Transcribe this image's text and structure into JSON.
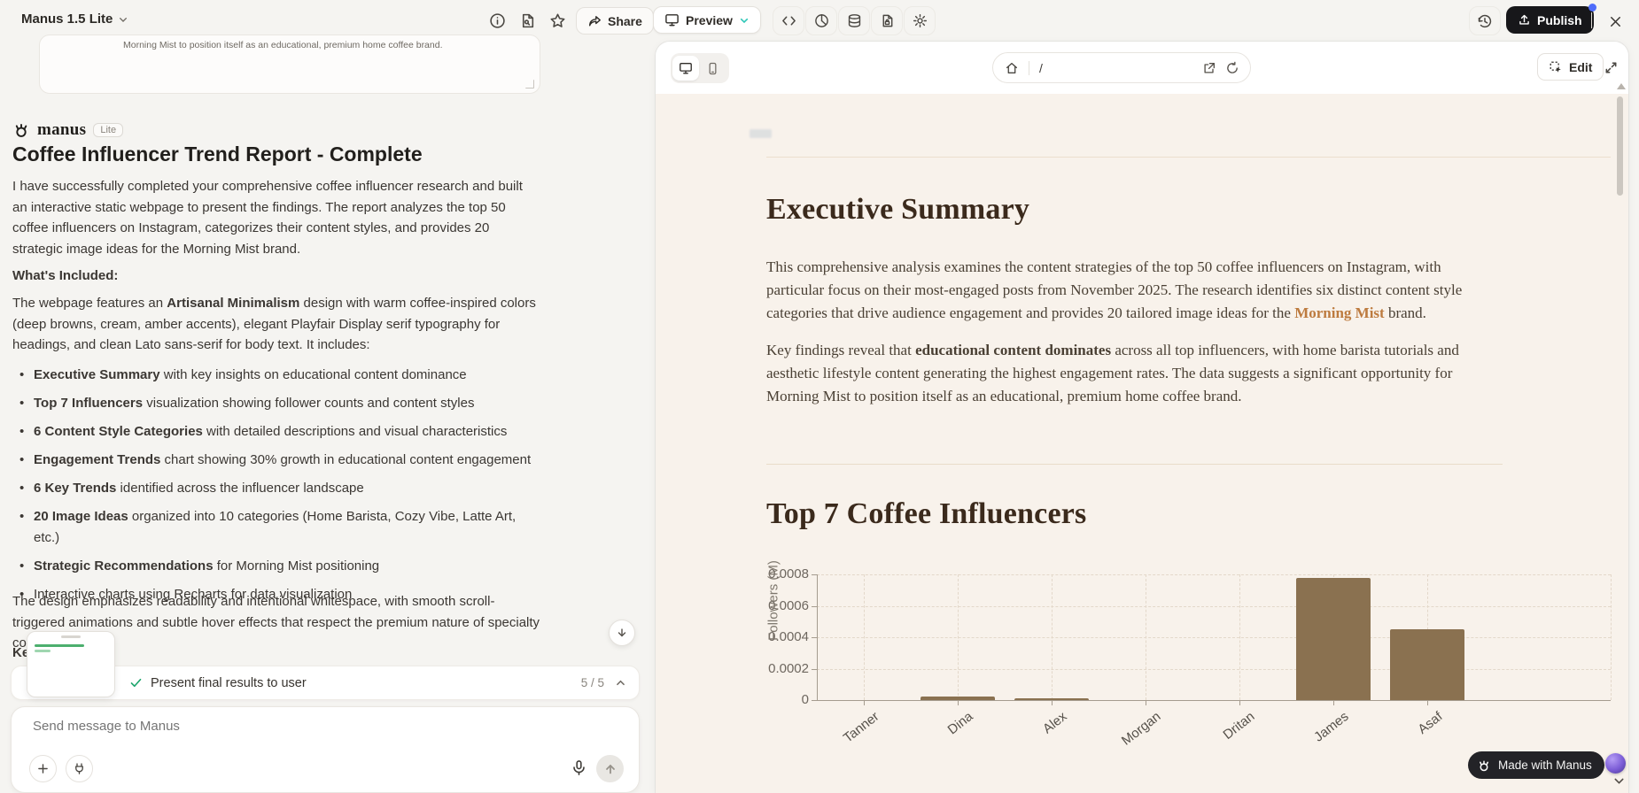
{
  "top": {
    "window_title": "Manus 1.5 Lite",
    "share_label": "Share",
    "preview_label": "Preview",
    "publish_label": "Publish"
  },
  "left": {
    "quoted_text": "Morning Mist to position itself as an educational, premium home coffee brand.",
    "brand": {
      "name": "manus",
      "badge": "Lite"
    },
    "title": "Coffee Influencer Trend Report - Complete",
    "intro": "I have successfully completed your comprehensive coffee influencer research and built an interactive static webpage to present the findings. The report analyzes the top 50 coffee influencers on Instagram, categorizes their content styles, and provides 20 strategic image ideas for the Morning Mist brand.",
    "whats_included": "What's Included:",
    "design_para": {
      "t1": "The webpage features an ",
      "b": "Artisanal Minimalism",
      "t2": " design with warm coffee-inspired colors (deep browns, cream, amber accents), elegant Playfair Display serif typography for headings, and clean Lato sans-serif for body text. It includes:"
    },
    "bullets": [
      {
        "b": "Executive Summary",
        "r": " with key insights on educational content dominance"
      },
      {
        "b": "Top 7 Influencers",
        "r": " visualization showing follower counts and content styles"
      },
      {
        "b": "6 Content Style Categories",
        "r": " with detailed descriptions and visual characteristics"
      },
      {
        "b": "Engagement Trends",
        "r": " chart showing 30% growth in educational content engagement"
      },
      {
        "b": "6 Key Trends",
        "r": " identified across the influencer landscape"
      },
      {
        "b": "20 Image Ideas",
        "r": " organized into 10 categories (Home Barista, Cozy Vibe, Latte Art, etc.)"
      },
      {
        "b": "Strategic Recommendations",
        "r": " for Morning Mist positioning"
      },
      {
        "b": "",
        "r": "Interactive charts using Recharts for data visualization"
      }
    ],
    "closing": "The design emphasizes readability and intentional whitespace, with smooth scroll-triggered animations and subtle hover effects that respect the premium nature of specialty coffee culture",
    "fragment": "Ke",
    "task": {
      "label": "Present final results to user",
      "progress": "5 / 5"
    },
    "composer": {
      "placeholder": "Send message to Manus"
    }
  },
  "right": {
    "address_path": "/",
    "edit_label": "Edit",
    "page": {
      "h1": "Executive Summary",
      "p1": {
        "t1": "This comprehensive analysis examines the content strategies of the top 50 coffee influencers on Instagram, with particular focus on their most-engaged posts from November 2025. The research identifies six distinct content style categories that drive audience engagement and provides 20 tailored image ideas for the ",
        "accent": "Morning Mist",
        "t2": " brand."
      },
      "p2": {
        "t1": "Key findings reveal that ",
        "b": "educational content dominates",
        "t2": " across all top influencers, with home barista tutorials and aesthetic lifestyle content generating the highest engagement rates. The data suggests a significant opportunity for Morning Mist to position itself as an educational, premium home coffee brand."
      },
      "h2": "Top 7 Coffee Influencers"
    },
    "made_with": "Made with Manus"
  },
  "colors": {
    "accent_amber": "#bd7b3f",
    "heading_brown": "#3b2a1c",
    "bar_brown": "#8a7150",
    "publish_black": "#17171a",
    "notify_blue": "#4e6cfa",
    "teal": "#2fc7b8",
    "check_green": "#1ea66d",
    "cream_bg": "#f8f2eb"
  },
  "chart_data": {
    "type": "bar",
    "title": "Top 7 Coffee Influencers",
    "categories": [
      "Tanner",
      "Dina",
      "Alex",
      "Morgan",
      "Dritan",
      "James",
      "Asaf"
    ],
    "values": [
      0,
      2e-05,
      1e-05,
      0,
      0,
      0.00078,
      0.00045
    ],
    "xlabel": "",
    "ylabel": "Followers (M)",
    "ylim": [
      0,
      0.0008
    ],
    "yticks": [
      0,
      0.0002,
      0.0004,
      0.0006,
      0.0008
    ],
    "ytick_labels": [
      "0",
      "0.0002",
      "0.0004",
      "0.0006",
      "0.0008"
    ],
    "grid": "dashed",
    "legend": false,
    "bar_color": "#8a7150"
  }
}
